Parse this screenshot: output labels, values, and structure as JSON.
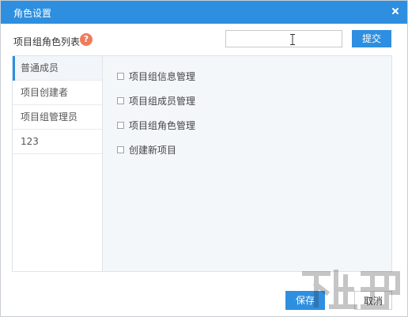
{
  "dialog": {
    "title": "角色设置",
    "close_icon": "close-icon"
  },
  "header": {
    "section_label": "项目组角色列表",
    "help_icon_glyph": "?",
    "search_value": "",
    "submit_label": "提交"
  },
  "roles": [
    {
      "label": "普通成员",
      "active": true
    },
    {
      "label": "项目创建者",
      "active": false
    },
    {
      "label": "项目组管理员",
      "active": false
    },
    {
      "label": "123",
      "active": false
    }
  ],
  "permissions": [
    {
      "label": "项目组信息管理",
      "checked": false
    },
    {
      "label": "项目组成员管理",
      "checked": false
    },
    {
      "label": "项目组角色管理",
      "checked": false
    },
    {
      "label": "创建新项目",
      "checked": false
    }
  ],
  "footer": {
    "save_label": "保存",
    "cancel_label": "取消"
  },
  "colors": {
    "accent": "#2e8fe0",
    "help": "#f07b5c"
  }
}
